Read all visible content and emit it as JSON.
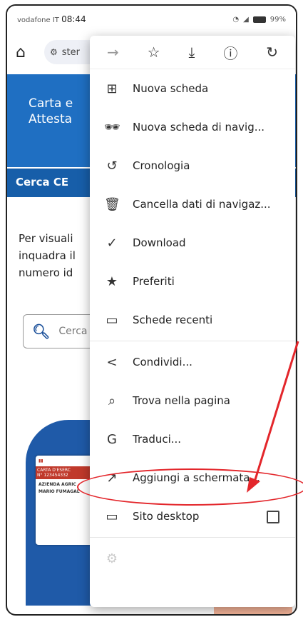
{
  "status_bar": {
    "carrier": "vodafone IT",
    "time": "08:44",
    "battery": "99%"
  },
  "toolbar": {
    "url_text": "ster"
  },
  "page": {
    "banner_line1": "Carta e",
    "banner_line2": "Attesta",
    "subnav": "Cerca CE",
    "para_line1": "Per visuali",
    "para_line2": "inquadra il",
    "para_line3": "numero id",
    "search_placeholder": "Cerca",
    "card": {
      "header": "CARTA D'ESERC",
      "number": "N° 123454332",
      "line1": "AZIENDA AGRIC",
      "line2": "MARIO FUMAGAL"
    }
  },
  "menu": {
    "items": [
      {
        "icon": "new-tab-icon",
        "label": "Nuova scheda"
      },
      {
        "icon": "incognito-icon",
        "label": "Nuova scheda di navig..."
      },
      {
        "icon": "history-icon",
        "label": "Cronologia"
      },
      {
        "icon": "trash-icon",
        "label": "Cancella dati di navigaz..."
      },
      {
        "icon": "download-icon",
        "label": "Download"
      },
      {
        "icon": "star-icon",
        "label": "Preferiti"
      },
      {
        "icon": "recent-tabs-icon",
        "label": "Schede recenti"
      },
      {
        "icon": "share-icon",
        "label": "Condividi..."
      },
      {
        "icon": "find-icon",
        "label": "Trova nella pagina"
      },
      {
        "icon": "translate-icon",
        "label": "Traduci..."
      },
      {
        "icon": "add-to-home-icon",
        "label": "Aggiungi a schermata..."
      },
      {
        "icon": "desktop-icon",
        "label": "Sito desktop"
      }
    ]
  },
  "colors": {
    "annotation": "#e3262b",
    "banner": "#1f6fc2"
  }
}
